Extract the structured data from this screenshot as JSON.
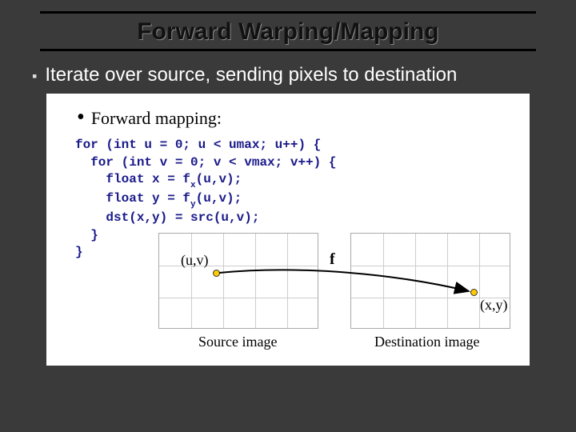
{
  "title": "Forward Warping/Mapping",
  "bullet": "Iterate over source, sending pixels to destination",
  "sub_bullet": "Forward mapping:",
  "code": {
    "l1": "for (int u = 0; u < umax; u++) {",
    "l2": "  for (int v = 0; v < vmax; v++) {",
    "l3a": "    float x = f",
    "l3s": "x",
    "l3b": "(u,v);",
    "l4a": "    float y = f",
    "l4s": "y",
    "l4b": "(u,v);",
    "l5": "    dst(x,y) = src(u,v);",
    "l6": "  }",
    "l7": "}"
  },
  "diagram": {
    "src_caption": "Source image",
    "dst_caption": "Destination image",
    "uv_label": "(u,v)",
    "xy_label": "(x,y)",
    "f_label": "f"
  }
}
